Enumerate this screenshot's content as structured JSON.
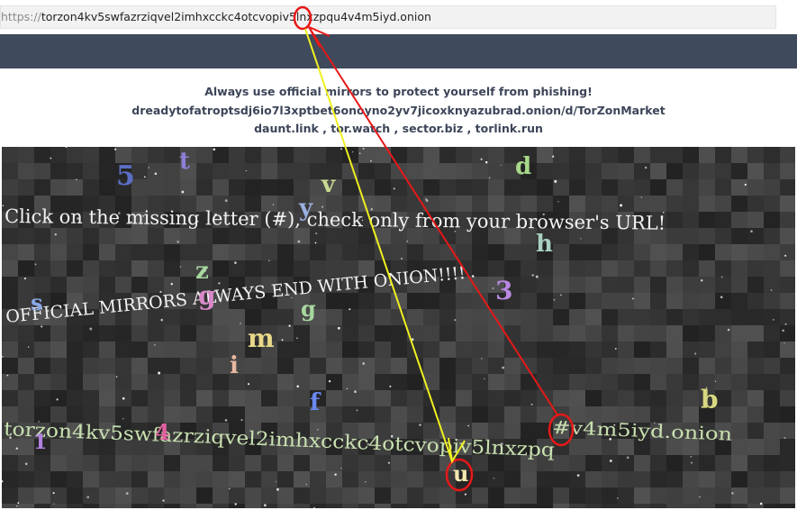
{
  "address_bar": {
    "scheme": "https://",
    "host": "torzon4kv5swfazrziqvel2imhxcckc4otcvopiv5lnxzpqu4v4m5iyd.onion"
  },
  "notice": {
    "line1": "Always use official mirrors to protect yourself from phishing!",
    "line2": "dreadytofatroptsdj6io7l3xptbet6onoyno2yv7jicoxknyazubrad.onion/d/TorZonMarket",
    "line3": "daunt.link , tor.watch , sector.biz , torlink.run"
  },
  "captcha": {
    "instruction": "Click on the missing letter (#), check only from your browser's URL!",
    "warning": "OFFICIAL MIRRORS ALWAYS END WITH ONION!!!!",
    "partial_url_left": "torzon4kv5swfazrziqvel2imhxcckc4otcvopiv5lnxzpq",
    "partial_url_right": "#v4m5iyd.onion",
    "answer_letter": "u",
    "letters": [
      "5",
      "t",
      "d",
      "v",
      "y",
      "h",
      "z",
      "g",
      "3",
      "s",
      "g",
      "m",
      "i",
      "f",
      "b",
      "1",
      "4"
    ],
    "letter_colors": [
      "#5a6fc4",
      "#8b7fd6",
      "#a8d88a",
      "#c8d890",
      "#9ab0e0",
      "#a8d0c0",
      "#a8d8a0",
      "#d888c8",
      "#b888e0",
      "#8aa8e8",
      "#a8d8a0",
      "#e8d888",
      "#e8b8a0",
      "#6a88f0",
      "#d8d880",
      "#b080e0",
      "#e060a0"
    ],
    "background": "#3a3a3a",
    "text_color": "#f2f2f2",
    "url_text_color": "#c8e0b0"
  },
  "annotations": {
    "red_color": "#e81818",
    "yellow_color": "#f0f020"
  }
}
